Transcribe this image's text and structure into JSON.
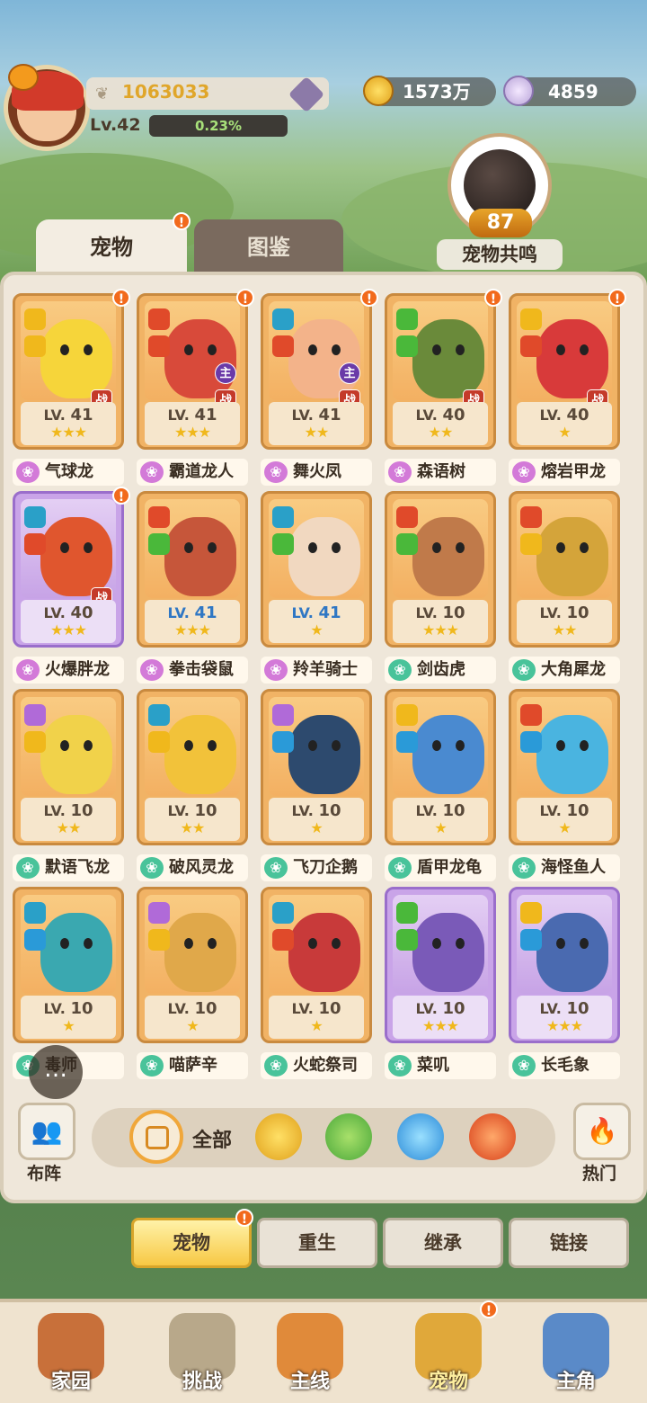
{
  "player": {
    "power": "1063033",
    "level": "Lv.42",
    "exp_percent": "0.23%"
  },
  "currencies": [
    {
      "icon": "gold-coin-icon",
      "value": "1573万"
    },
    {
      "icon": "shell-icon",
      "value": "4859"
    }
  ],
  "resonance": {
    "value": "87",
    "label": "宠物共鸣"
  },
  "tabs": [
    {
      "label": "宠物",
      "active": true
    },
    {
      "label": "图鉴",
      "active": false
    }
  ],
  "pets": [
    {
      "name": "气球龙",
      "lv": "41",
      "stars": "★★★",
      "badge": "战",
      "alert": true,
      "paw": "pink",
      "color": "#f6d53a",
      "icons": [
        "shield-icon",
        "sun-icon"
      ]
    },
    {
      "name": "霸道龙人",
      "lv": "41",
      "stars": "★★★",
      "badge": "战",
      "lord": "主",
      "alert": true,
      "paw": "pink",
      "color": "#d84a3a",
      "icons": [
        "axe-icon",
        "fire-icon"
      ]
    },
    {
      "name": "舞火凤",
      "lv": "41",
      "stars": "★★",
      "badge": "战",
      "lord": "主",
      "alert": true,
      "paw": "pink",
      "color": "#f3b38a",
      "icons": [
        "staff-icon",
        "fire-icon"
      ]
    },
    {
      "name": "森语树",
      "lv": "40",
      "stars": "★★",
      "badge": "战",
      "alert": true,
      "paw": "pink",
      "color": "#6a8a3a",
      "icons": [
        "heart-icon",
        "leaf-icon"
      ]
    },
    {
      "name": "熔岩甲龙",
      "lv": "40",
      "stars": "★",
      "badge": "战",
      "alert": true,
      "paw": "pink",
      "color": "#d83a3a",
      "icons": [
        "shield-icon",
        "fire-icon"
      ]
    },
    {
      "name": "火爆胖龙",
      "lv": "40",
      "stars": "★★★",
      "badge": "战",
      "alert": true,
      "paw": "pink",
      "color": "#e0562e",
      "purple": true,
      "icons": [
        "staff-icon",
        "fire-icon"
      ]
    },
    {
      "name": "拳击袋鼠",
      "lv": "41",
      "stars": "★★★",
      "blue": true,
      "paw": "pink",
      "color": "#c6563a",
      "icons": [
        "axe-icon",
        "leaf-icon"
      ]
    },
    {
      "name": "羚羊骑士",
      "lv": "41",
      "stars": "★",
      "blue": true,
      "paw": "pink",
      "color": "#f1d8c0",
      "icons": [
        "staff-icon",
        "leaf-icon"
      ]
    },
    {
      "name": "剑齿虎",
      "lv": "10",
      "stars": "★★★",
      "paw": "green",
      "color": "#c07a4a",
      "icons": [
        "axe-icon",
        "leaf-icon"
      ]
    },
    {
      "name": "大角犀龙",
      "lv": "10",
      "stars": "★★",
      "paw": "green",
      "color": "#d4a43a",
      "icons": [
        "axe-icon",
        "sun-icon"
      ]
    },
    {
      "name": "默语飞龙",
      "lv": "10",
      "stars": "★★",
      "paw": "green",
      "color": "#f1d24a",
      "icons": [
        "spiral-icon",
        "sun-icon"
      ]
    },
    {
      "name": "破风灵龙",
      "lv": "10",
      "stars": "★★",
      "paw": "green",
      "color": "#f2c23a",
      "icons": [
        "staff-icon",
        "sun-icon"
      ]
    },
    {
      "name": "飞刀企鹅",
      "lv": "10",
      "stars": "★",
      "paw": "green",
      "color": "#2d4a6e",
      "icons": [
        "spiral-icon",
        "water-icon"
      ]
    },
    {
      "name": "盾甲龙龟",
      "lv": "10",
      "stars": "★",
      "paw": "green",
      "color": "#4a8ad0",
      "icons": [
        "shield-icon",
        "water-icon"
      ]
    },
    {
      "name": "海怪鱼人",
      "lv": "10",
      "stars": "★",
      "paw": "green",
      "color": "#4ab4e0",
      "icons": [
        "axe-icon",
        "water-icon"
      ]
    },
    {
      "name": "毒师",
      "lv": "10",
      "stars": "★",
      "paw": "green",
      "color": "#3aa8b0",
      "icons": [
        "staff-icon",
        "water-icon"
      ]
    },
    {
      "name": "喵萨辛",
      "lv": "10",
      "stars": "★",
      "paw": "green",
      "color": "#e0a84a",
      "icons": [
        "spiral-icon",
        "sun-icon"
      ]
    },
    {
      "name": "火蛇祭司",
      "lv": "10",
      "stars": "★",
      "paw": "green",
      "color": "#c83a3a",
      "icons": [
        "staff-icon",
        "fire-icon"
      ]
    },
    {
      "name": "菜叽",
      "lv": "10",
      "stars": "★★★",
      "paw": "green",
      "color": "#7a5ab8",
      "purple": true,
      "icons": [
        "heart-icon",
        "leaf-icon"
      ]
    },
    {
      "name": "长毛象",
      "lv": "10",
      "stars": "★★★",
      "paw": "green",
      "color": "#4a6ab0",
      "purple": true,
      "icons": [
        "shield-icon",
        "water-icon"
      ]
    }
  ],
  "lv_prefix": "LV.",
  "filter": {
    "formation_label": "布阵",
    "all_label": "全部",
    "hot_label": "热门",
    "elements": [
      "sun-icon",
      "leaf-icon",
      "water-icon",
      "fire-icon"
    ]
  },
  "actions": [
    {
      "label": "宠物",
      "active": true,
      "alert": true
    },
    {
      "label": "重生",
      "active": false
    },
    {
      "label": "继承",
      "active": false
    },
    {
      "label": "链接",
      "active": false
    }
  ],
  "nav": [
    {
      "label": "家园",
      "color": "#c8703a"
    },
    {
      "label": "挑战",
      "color": "#b8a88a"
    },
    {
      "label": "主线",
      "color": "#e08a3a"
    },
    {
      "label": "宠物",
      "color": "#e0a83a",
      "active": true,
      "alert": true
    },
    {
      "label": "主角",
      "color": "#5a8ac8"
    }
  ],
  "colors": {
    "accent": "#f0a73a",
    "alert": "#f26a1c",
    "gold_text": "#e0a62a"
  }
}
